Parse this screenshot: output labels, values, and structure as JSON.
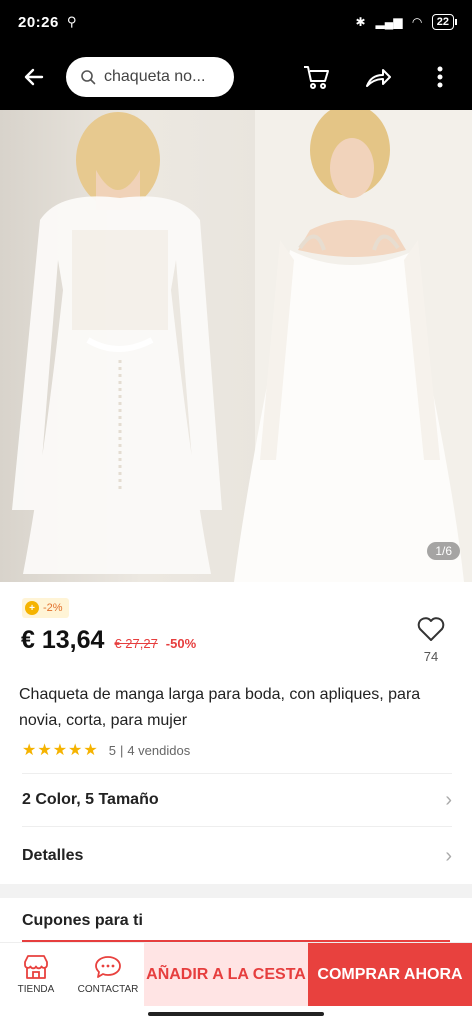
{
  "status_bar": {
    "time": "20:26",
    "battery": "22"
  },
  "header": {
    "search_text": "chaqueta no...",
    "icons": [
      "back-arrow-icon",
      "search-icon",
      "cart-icon",
      "share-icon",
      "more-icon"
    ]
  },
  "gallery": {
    "indicator": "1/6"
  },
  "product": {
    "discount_chip": "-2%",
    "price": "€ 13,64",
    "old_price": "€ 27,27",
    "discount_pct": "-50%",
    "wishlist_count": "74",
    "title": "Chaqueta de manga larga para boda, con apliques, para novia, corta, para mujer",
    "stars": "★★★★★",
    "rating": "5",
    "sold": "4 vendidos",
    "rating_separator": "|"
  },
  "options": {
    "variants_label": "2 Color, 5 Tamaño",
    "details_label": "Detalles",
    "chevron": "›"
  },
  "coupons": {
    "title": "Cupones para ti"
  },
  "bottom_bar": {
    "store_label": "TIENDA",
    "contact_label": "CONTACTAR",
    "add_to_cart": "AÑADIR A LA CESTA",
    "buy_now": "COMPRAR AHORA"
  },
  "colors": {
    "accent": "#e8413e",
    "cart_bg": "#ffe4e4",
    "star": "#f5b300"
  }
}
